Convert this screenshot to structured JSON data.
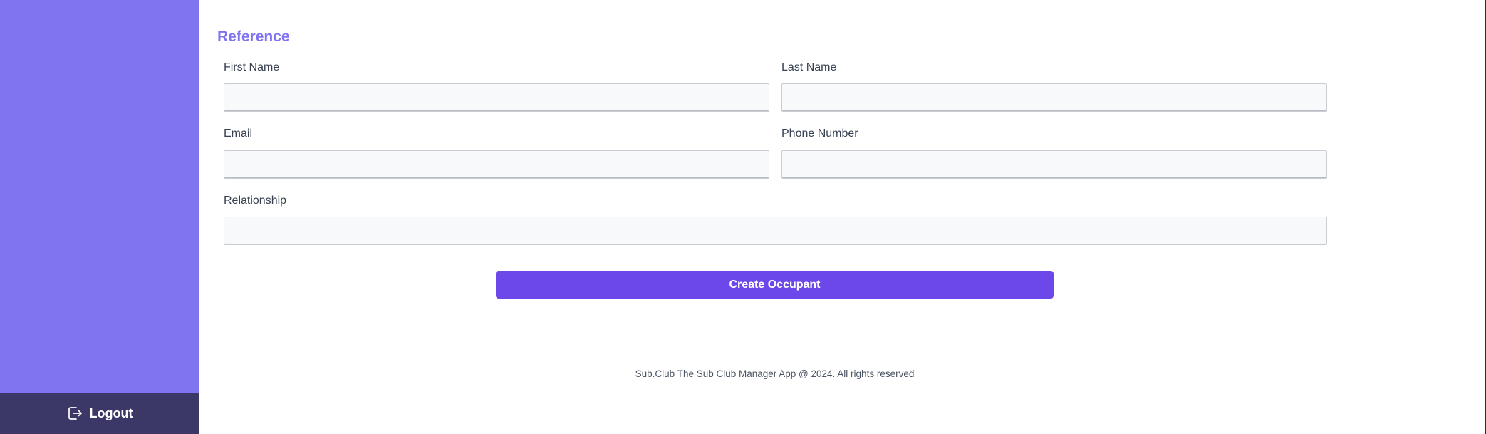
{
  "sidebar": {
    "logout_label": "Logout"
  },
  "form": {
    "section_title": "Reference",
    "first_name": {
      "label": "First Name",
      "value": "",
      "placeholder": ""
    },
    "last_name": {
      "label": "Last Name",
      "value": "",
      "placeholder": ""
    },
    "email": {
      "label": "Email",
      "value": "",
      "placeholder": ""
    },
    "phone_number": {
      "label": "Phone Number",
      "value": "",
      "placeholder": ""
    },
    "relationship": {
      "label": "Relationship",
      "value": "",
      "placeholder": ""
    },
    "submit_label": "Create Occupant"
  },
  "footer": {
    "text": "Sub.Club The Sub Club Manager App @ 2024. All rights reserved"
  },
  "colors": {
    "sidebar": "#8075f0",
    "logout_bar": "#3b3766",
    "accent": "#6c47ea",
    "section_title": "#8075f0"
  },
  "icons": {
    "logout": "logout-icon"
  }
}
